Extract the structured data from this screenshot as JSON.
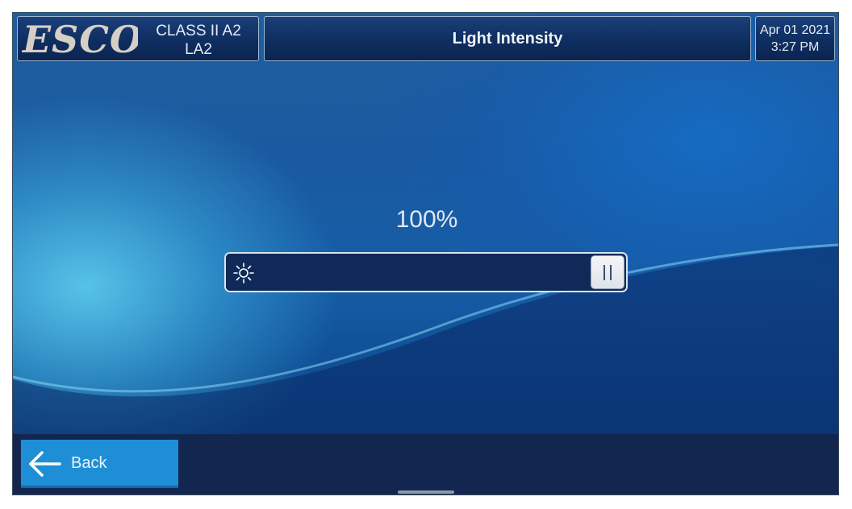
{
  "header": {
    "logo_text": "ESCO",
    "model_line1": "CLASS II A2",
    "model_line2": "LA2",
    "title": "Light Intensity",
    "date": "Apr 01 2021",
    "time": "3:27 PM"
  },
  "control": {
    "value_label": "100%",
    "value": 100,
    "icon": "sun-icon",
    "thumb_icon": "pause-bars-icon"
  },
  "footer": {
    "back_label": "Back",
    "back_icon": "arrow-left-icon"
  },
  "colors": {
    "header_bg": "#0f2e60",
    "slider_bg": "#0f2a58",
    "back_button": "#1e8fd6",
    "footer_bg": "#13264f"
  }
}
